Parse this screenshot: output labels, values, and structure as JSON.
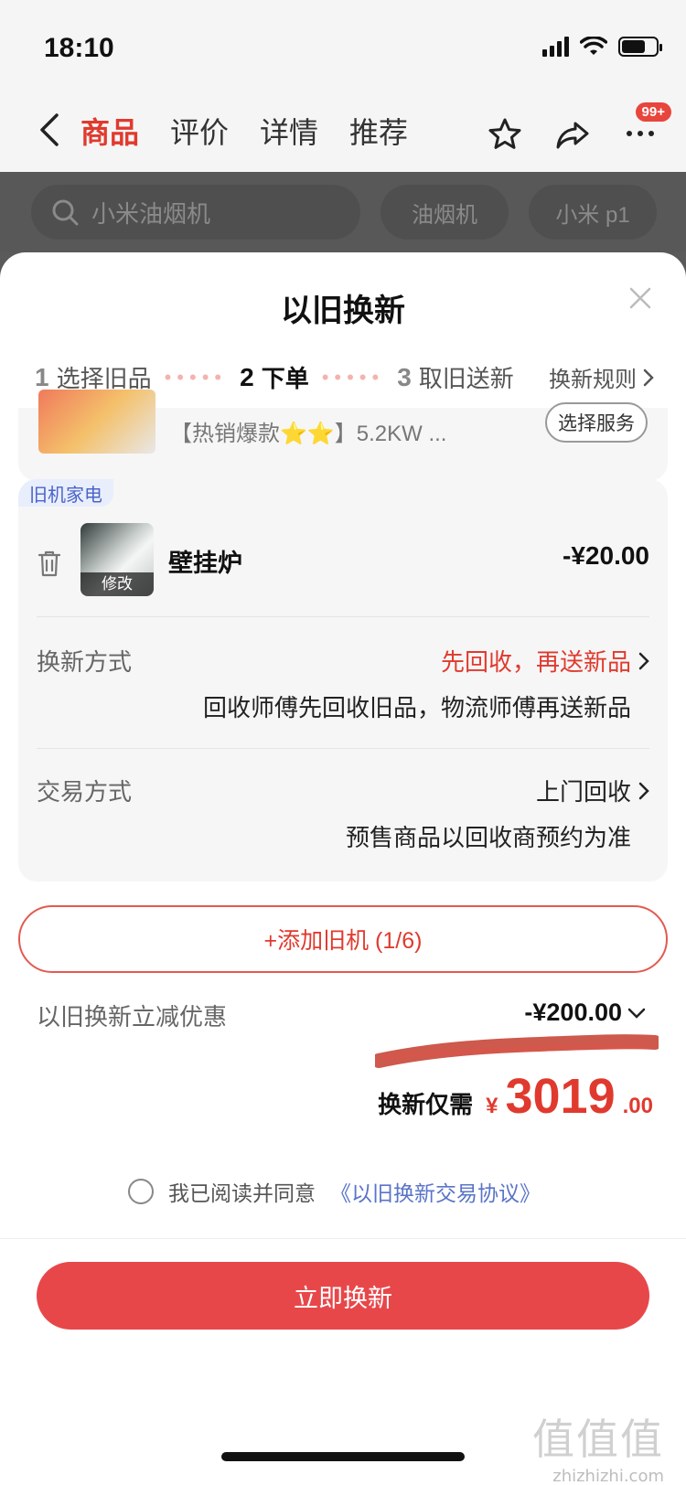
{
  "status_bar": {
    "time": "18:10"
  },
  "header": {
    "tabs": [
      {
        "label": "商品",
        "active": true
      },
      {
        "label": "评价",
        "active": false
      },
      {
        "label": "详情",
        "active": false
      },
      {
        "label": "推荐",
        "active": false
      }
    ],
    "badge": "99+",
    "icons": [
      "chevron-left-icon",
      "star-icon",
      "share-icon",
      "more-icon"
    ]
  },
  "search": {
    "placeholder": "小米油烟机",
    "chips": [
      "油烟机",
      "小米 p1"
    ]
  },
  "sheet": {
    "title": "以旧换新",
    "steps": [
      {
        "num": "1",
        "label": "选择旧品"
      },
      {
        "num": "2",
        "label": "下单"
      },
      {
        "num": "3",
        "label": "取旧送新"
      }
    ],
    "rules_label": "换新规则",
    "product": {
      "name": "【热销爆款⭐⭐】5.2KW ...",
      "service_button": "选择服务"
    },
    "old_item": {
      "tag": "旧机家电",
      "thumb_label": "修改",
      "name": "壁挂炉",
      "price": "-¥20.00",
      "exchange_method_label": "换新方式",
      "exchange_method_value": "先回收，再送新品",
      "exchange_method_note": "回收师傅先回收旧品，物流师傅再送新品",
      "trade_method_label": "交易方式",
      "trade_method_value": "上门回收",
      "trade_method_note": "预售商品以回收商预约为准"
    },
    "add_button": "+添加旧机 (1/6)",
    "discount_label": "以旧换新立减优惠",
    "discount_value": "-¥200.00",
    "total_label": "换新仅需",
    "total_currency": "¥",
    "total_int": "3019",
    "total_dec": ".00",
    "agree_text": "我已阅读并同意",
    "agree_link": "《以旧换新交易协议》",
    "cta": "立即换新"
  },
  "watermark": {
    "glyphs": "值值值",
    "text": "zhizhizhi.com"
  },
  "colors": {
    "accent": "#e03a2e",
    "cta": "#e8474a",
    "link": "#5a74c8"
  }
}
